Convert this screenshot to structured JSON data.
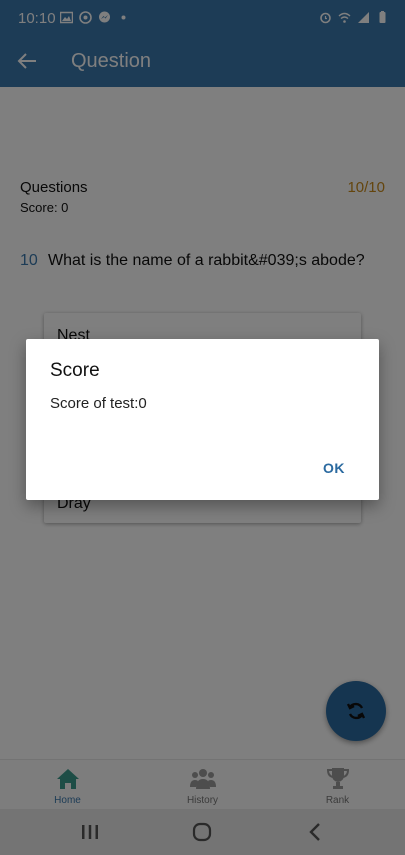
{
  "status_bar": {
    "time": "10:10",
    "left_icons": [
      "image-icon",
      "vpn-icon",
      "messenger-icon",
      "dot-icon"
    ],
    "right_icons": [
      "alarm-icon",
      "wifi-icon",
      "signal-icon",
      "battery-icon"
    ]
  },
  "app_bar": {
    "title": "Question",
    "back_icon": "back-arrow-icon"
  },
  "quiz": {
    "header_label": "Questions",
    "progress": "10/10",
    "score": "Score: 0",
    "question_number": "10",
    "question_text": "What is the name of a rabbit&#039;s abode?",
    "answers": [
      "Nest",
      "Dray"
    ]
  },
  "fab": {
    "icon": "refresh-icon"
  },
  "bottom_nav": {
    "items": [
      {
        "label": "Home",
        "icon": "home-icon",
        "active": true
      },
      {
        "label": "History",
        "icon": "people-icon",
        "active": false
      },
      {
        "label": "Rank",
        "icon": "trophy-icon",
        "active": false
      }
    ]
  },
  "dialog": {
    "title": "Score",
    "message": "Score of test:0",
    "ok_label": "OK"
  },
  "colors": {
    "primary": "#3a78ad",
    "accent": "#c98a1b",
    "fab": "#2b6aa0"
  }
}
